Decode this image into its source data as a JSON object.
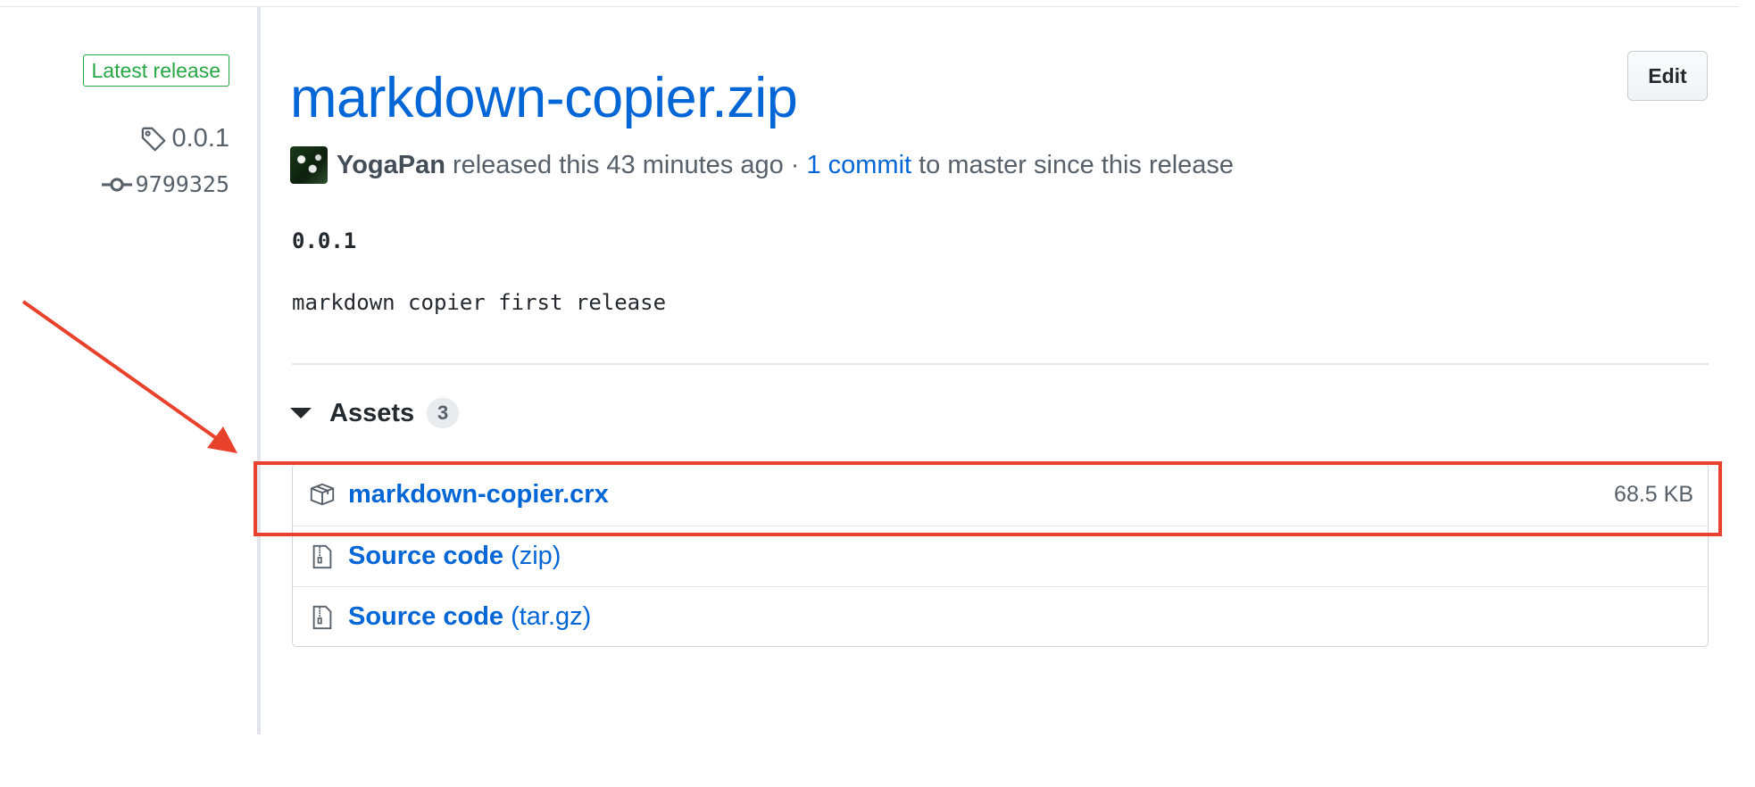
{
  "sidebar": {
    "badge": "Latest release",
    "tag": "0.0.1",
    "commit": "9799325"
  },
  "release": {
    "title": "markdown-copier.zip",
    "edit_label": "Edit",
    "author": "YogaPan",
    "released_text": "released this 43 minutes ago ·",
    "commits_link": "1 commit",
    "commits_suffix": "to master since this release"
  },
  "notes": {
    "version": "0.0.1",
    "body": "markdown copier first release"
  },
  "assets": {
    "label": "Assets",
    "count": "3",
    "items": [
      {
        "name": "markdown-copier.crx",
        "suffix": "",
        "size": "68.5 KB",
        "icon": "package-icon"
      },
      {
        "name": "Source code",
        "suffix": "(zip)",
        "size": "",
        "icon": "file-zip-icon"
      },
      {
        "name": "Source code",
        "suffix": "(tar.gz)",
        "size": "",
        "icon": "file-zip-icon"
      }
    ]
  },
  "annotation": {
    "color": "#e8412c",
    "target": "markdown-copier.crx"
  },
  "colors": {
    "link": "#0366d6",
    "badge_green": "#28a745",
    "annotation_red": "#e8412c"
  }
}
